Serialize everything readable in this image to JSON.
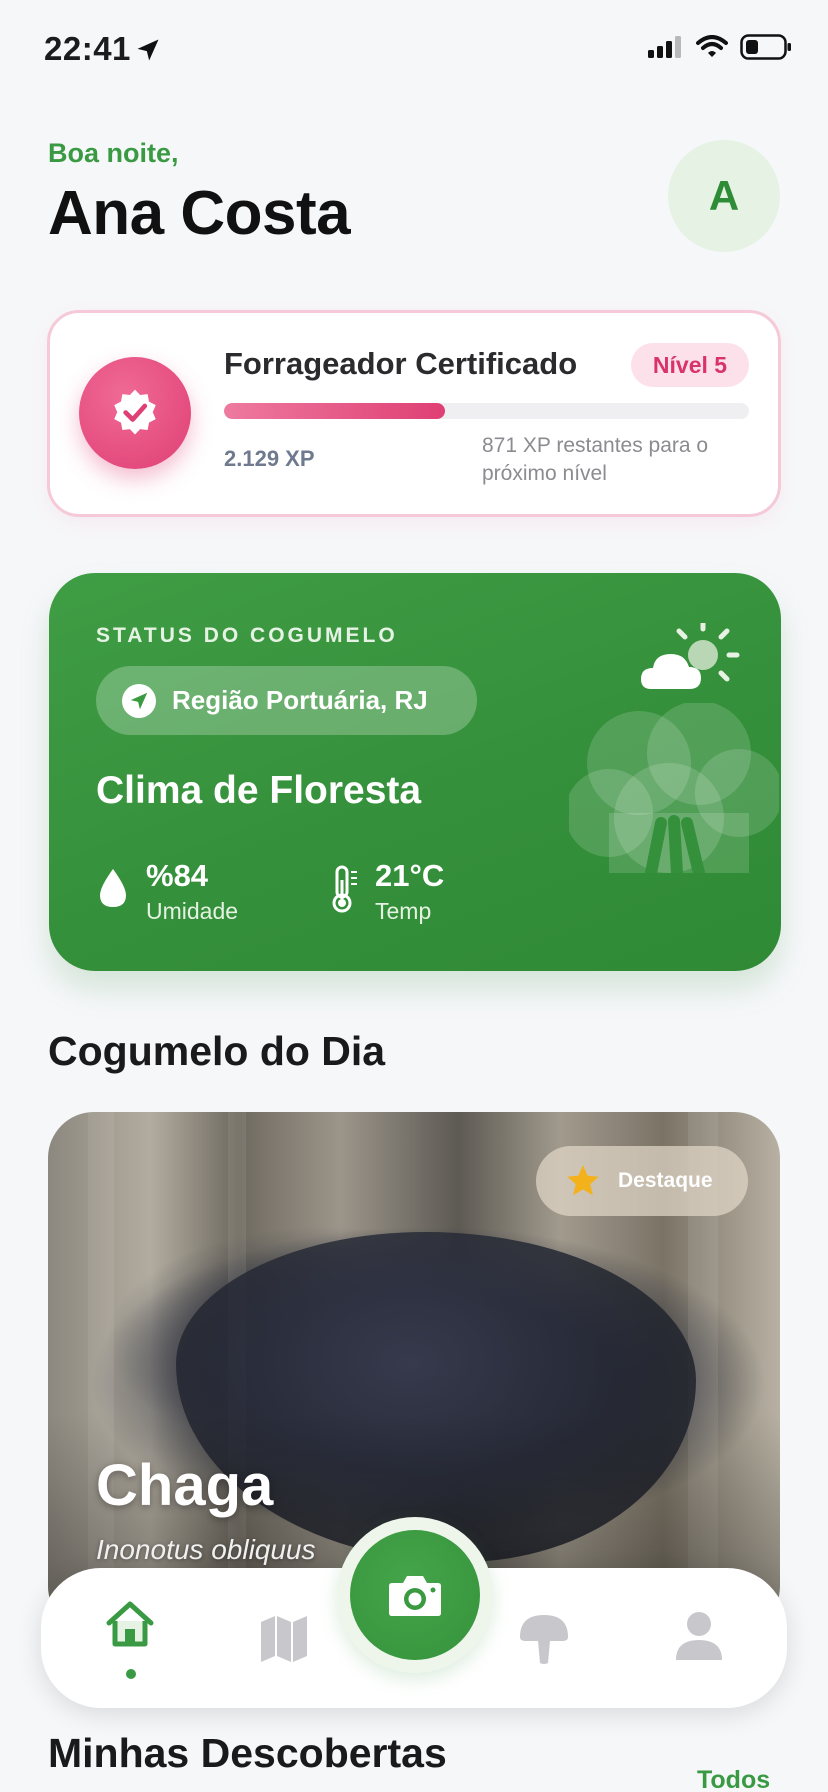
{
  "status_bar": {
    "time": "22:41"
  },
  "header": {
    "greeting": "Boa noite,",
    "user_name": "Ana Costa",
    "avatar_initial": "A"
  },
  "level_card": {
    "title": "Forrageador Certificado",
    "level_label": "Nível 5",
    "xp_current": "2.129 XP",
    "xp_remaining": "871 XP restantes para o próximo nível",
    "progress_fraction": 0.42,
    "accent": "#df3f74"
  },
  "weather_card": {
    "label": "STATUS DO COGUMELO",
    "location": "Região Portuária, RJ",
    "climate": "Clima de Floresta",
    "humidity_value": "%84",
    "humidity_label": "Umidade",
    "temp_value": "21°C",
    "temp_label": "Temp",
    "color": "#3a9a40"
  },
  "mushroom_of_day": {
    "section_title": "Cogumelo do Dia",
    "badge": "Destaque",
    "name": "Chaga",
    "scientific_name": "Inonotus obliquus"
  },
  "discoveries": {
    "section_title": "Minhas Descobertas",
    "see_all": "Todos"
  },
  "tab_bar": {
    "items": [
      {
        "icon": "home-icon",
        "active": true
      },
      {
        "icon": "map-icon",
        "active": false
      },
      {
        "icon": "camera-icon",
        "active": false
      },
      {
        "icon": "mushroom-icon",
        "active": false
      },
      {
        "icon": "profile-icon",
        "active": false
      }
    ],
    "active_color": "#3a9a44",
    "inactive_color": "#c8c8cc"
  }
}
